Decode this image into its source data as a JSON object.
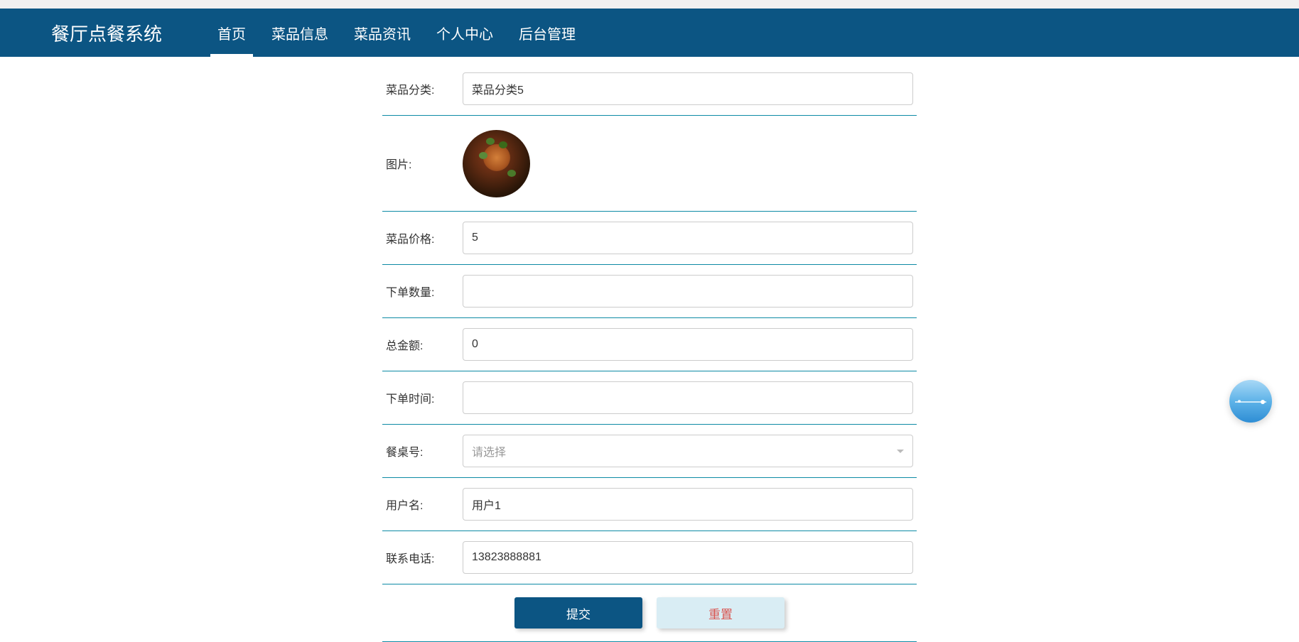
{
  "app": {
    "title": "餐厅点餐系统"
  },
  "nav": {
    "items": [
      {
        "label": "首页",
        "active": true
      },
      {
        "label": "菜品信息",
        "active": false
      },
      {
        "label": "菜品资讯",
        "active": false
      },
      {
        "label": "个人中心",
        "active": false
      },
      {
        "label": "后台管理",
        "active": false
      }
    ]
  },
  "form": {
    "fields": {
      "category": {
        "label": "菜品分类:",
        "value": "菜品分类5"
      },
      "image": {
        "label": "图片:"
      },
      "price": {
        "label": "菜品价格:",
        "value": "5"
      },
      "quantity": {
        "label": "下单数量:",
        "value": ""
      },
      "total": {
        "label": "总金额:",
        "value": "0"
      },
      "orderTime": {
        "label": "下单时间:",
        "value": ""
      },
      "tableNo": {
        "label": "餐桌号:",
        "placeholder": "请选择"
      },
      "username": {
        "label": "用户名:",
        "value": "用户1"
      },
      "phone": {
        "label": "联系电话:",
        "value": "13823888881"
      }
    },
    "buttons": {
      "submit": "提交",
      "reset": "重置"
    }
  }
}
